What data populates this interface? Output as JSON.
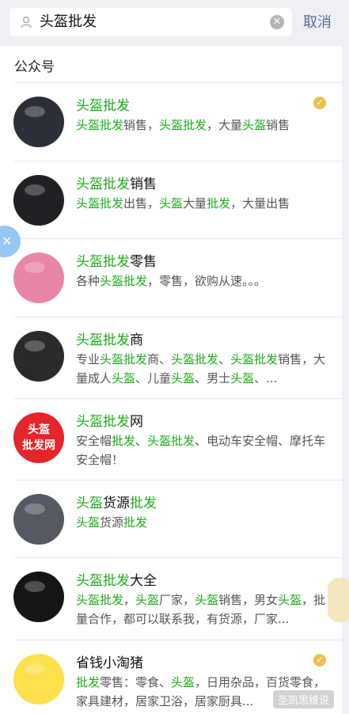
{
  "search": {
    "query": "头盔批发",
    "cancel_label": "取消"
  },
  "section_title": "公众号",
  "results": [
    {
      "title": [
        [
          "hl",
          "头盔批发"
        ]
      ],
      "desc": [
        [
          "hl",
          "头盔批发"
        ],
        [
          "n",
          "销售，"
        ],
        [
          "hl",
          "头盔批发"
        ],
        [
          "n",
          "，大量"
        ],
        [
          "hl",
          "头盔"
        ],
        [
          "n",
          "销售"
        ]
      ],
      "verified": true,
      "avatar": "black-helmet-photo"
    },
    {
      "title": [
        [
          "hl",
          "头盔批发"
        ],
        [
          "n",
          "销售"
        ]
      ],
      "desc": [
        [
          "hl",
          "头盔批发"
        ],
        [
          "n",
          "出售，"
        ],
        [
          "hl",
          "头盔"
        ],
        [
          "n",
          "大量"
        ],
        [
          "hl",
          "批发"
        ],
        [
          "n",
          "，大量出售"
        ]
      ],
      "verified": false,
      "avatar": "black-open-face-helmet-photo"
    },
    {
      "title": [
        [
          "hl",
          "头盔批发"
        ],
        [
          "n",
          "零售"
        ]
      ],
      "desc": [
        [
          "n",
          "各种"
        ],
        [
          "hl",
          "头盔批发"
        ],
        [
          "n",
          "，零售，欲购从速。。。"
        ]
      ],
      "verified": false,
      "avatar": "pink-helmet-photo"
    },
    {
      "title": [
        [
          "hl",
          "头盔批发"
        ],
        [
          "n",
          "商"
        ]
      ],
      "desc": [
        [
          "n",
          "专业"
        ],
        [
          "hl",
          "头盔批发"
        ],
        [
          "n",
          "商、"
        ],
        [
          "hl",
          "头盔批发"
        ],
        [
          "n",
          "、"
        ],
        [
          "hl",
          "头盔批发"
        ],
        [
          "n",
          "销售，大量成人"
        ],
        [
          "hl",
          "头盔"
        ],
        [
          "n",
          "、儿童"
        ],
        [
          "hl",
          "头盔"
        ],
        [
          "n",
          "、男士"
        ],
        [
          "hl",
          "头盔"
        ],
        [
          "n",
          "、..."
        ]
      ],
      "verified": false,
      "avatar": "half-helmet-photo"
    },
    {
      "title": [
        [
          "hl",
          "头盔批发"
        ],
        [
          "n",
          "网"
        ]
      ],
      "desc": [
        [
          "n",
          "安全帽"
        ],
        [
          "hl",
          "批发"
        ],
        [
          "n",
          "、"
        ],
        [
          "hl",
          "头盔批发"
        ],
        [
          "n",
          "、电动车安全帽、摩托车安全帽！"
        ]
      ],
      "verified": false,
      "avatar": "red-logo",
      "avatar_text": [
        "头盔",
        "批发网"
      ]
    },
    {
      "title": [
        [
          "hl",
          "头盔"
        ],
        [
          "n",
          "货源"
        ],
        [
          "hl",
          "批发"
        ]
      ],
      "desc": [
        [
          "hl",
          "头盔"
        ],
        [
          "n",
          "货源"
        ],
        [
          "hl",
          "批发"
        ]
      ],
      "verified": false,
      "avatar": "motorcycle-helmet-photo"
    },
    {
      "title": [
        [
          "hl",
          "头盔批发"
        ],
        [
          "n",
          "大全"
        ]
      ],
      "desc": [
        [
          "hl",
          "头盔批发"
        ],
        [
          "n",
          "，"
        ],
        [
          "hl",
          "头盔"
        ],
        [
          "n",
          "厂家，"
        ],
        [
          "hl",
          "头盔"
        ],
        [
          "n",
          "销售，男女"
        ],
        [
          "hl",
          "头盔"
        ],
        [
          "n",
          "，批量合作，都可以联系我，有货源，厂家..."
        ]
      ],
      "verified": false,
      "avatar": "offroad-helmet-photo"
    },
    {
      "title": [
        [
          "n",
          "省钱小淘猪"
        ]
      ],
      "desc": [
        [
          "hl",
          "批发"
        ],
        [
          "n",
          "零售：零食、"
        ],
        [
          "hl",
          "头盔"
        ],
        [
          "n",
          "，日用杂品，百货零食，家具建材，居家卫浴，居家厨具..."
        ]
      ],
      "verified": true,
      "avatar": "cartoon-duck"
    }
  ],
  "watermark": "圣凯思维说",
  "colors": {
    "highlight": "#1aad19",
    "link": "#576b95",
    "verify": "#e9c14d"
  }
}
